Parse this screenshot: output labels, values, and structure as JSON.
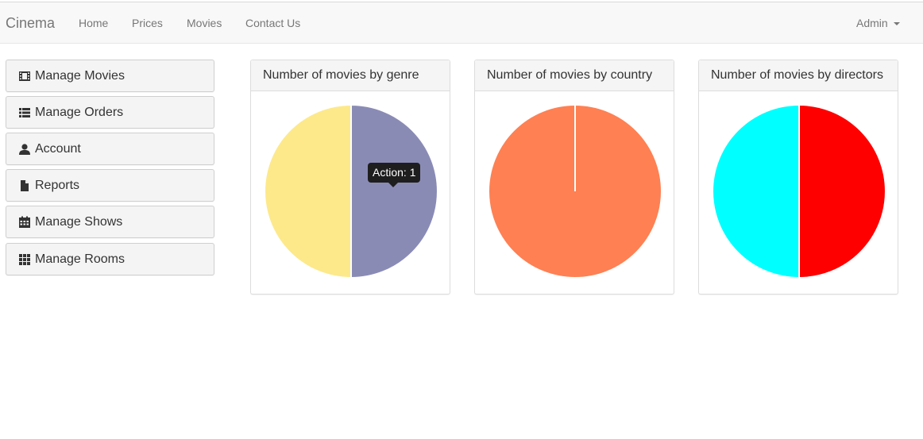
{
  "navbar": {
    "brand": "Cinema",
    "links": [
      "Home",
      "Prices",
      "Movies",
      "Contact Us"
    ],
    "user": "Admin"
  },
  "sidebar": {
    "items": [
      {
        "label": "Manage Movies",
        "icon": "film-icon"
      },
      {
        "label": "Manage Orders",
        "icon": "list-icon"
      },
      {
        "label": "Account",
        "icon": "user-icon"
      },
      {
        "label": "Reports",
        "icon": "file-icon"
      },
      {
        "label": "Manage Shows",
        "icon": "calendar-icon"
      },
      {
        "label": "Manage Rooms",
        "icon": "grid-icon"
      }
    ]
  },
  "panels": [
    {
      "title": "Number of movies by genre"
    },
    {
      "title": "Number of movies by country"
    },
    {
      "title": "Number of movies by directors"
    }
  ],
  "tooltip": {
    "text": "Action: 1"
  },
  "chart_data": [
    {
      "type": "pie",
      "title": "Number of movies by genre",
      "slices": [
        {
          "label": "Action",
          "value": 1,
          "color": "#8a8bb5"
        },
        {
          "label": "",
          "value": 1,
          "color": "#fde98a"
        }
      ]
    },
    {
      "type": "pie",
      "title": "Number of movies by country",
      "slices": [
        {
          "label": "",
          "value": 1,
          "color": "#ff8053"
        }
      ]
    },
    {
      "type": "pie",
      "title": "Number of movies by directors",
      "slices": [
        {
          "label": "",
          "value": 1,
          "color": "#ff0000"
        },
        {
          "label": "",
          "value": 1,
          "color": "#00ffff"
        }
      ]
    }
  ]
}
